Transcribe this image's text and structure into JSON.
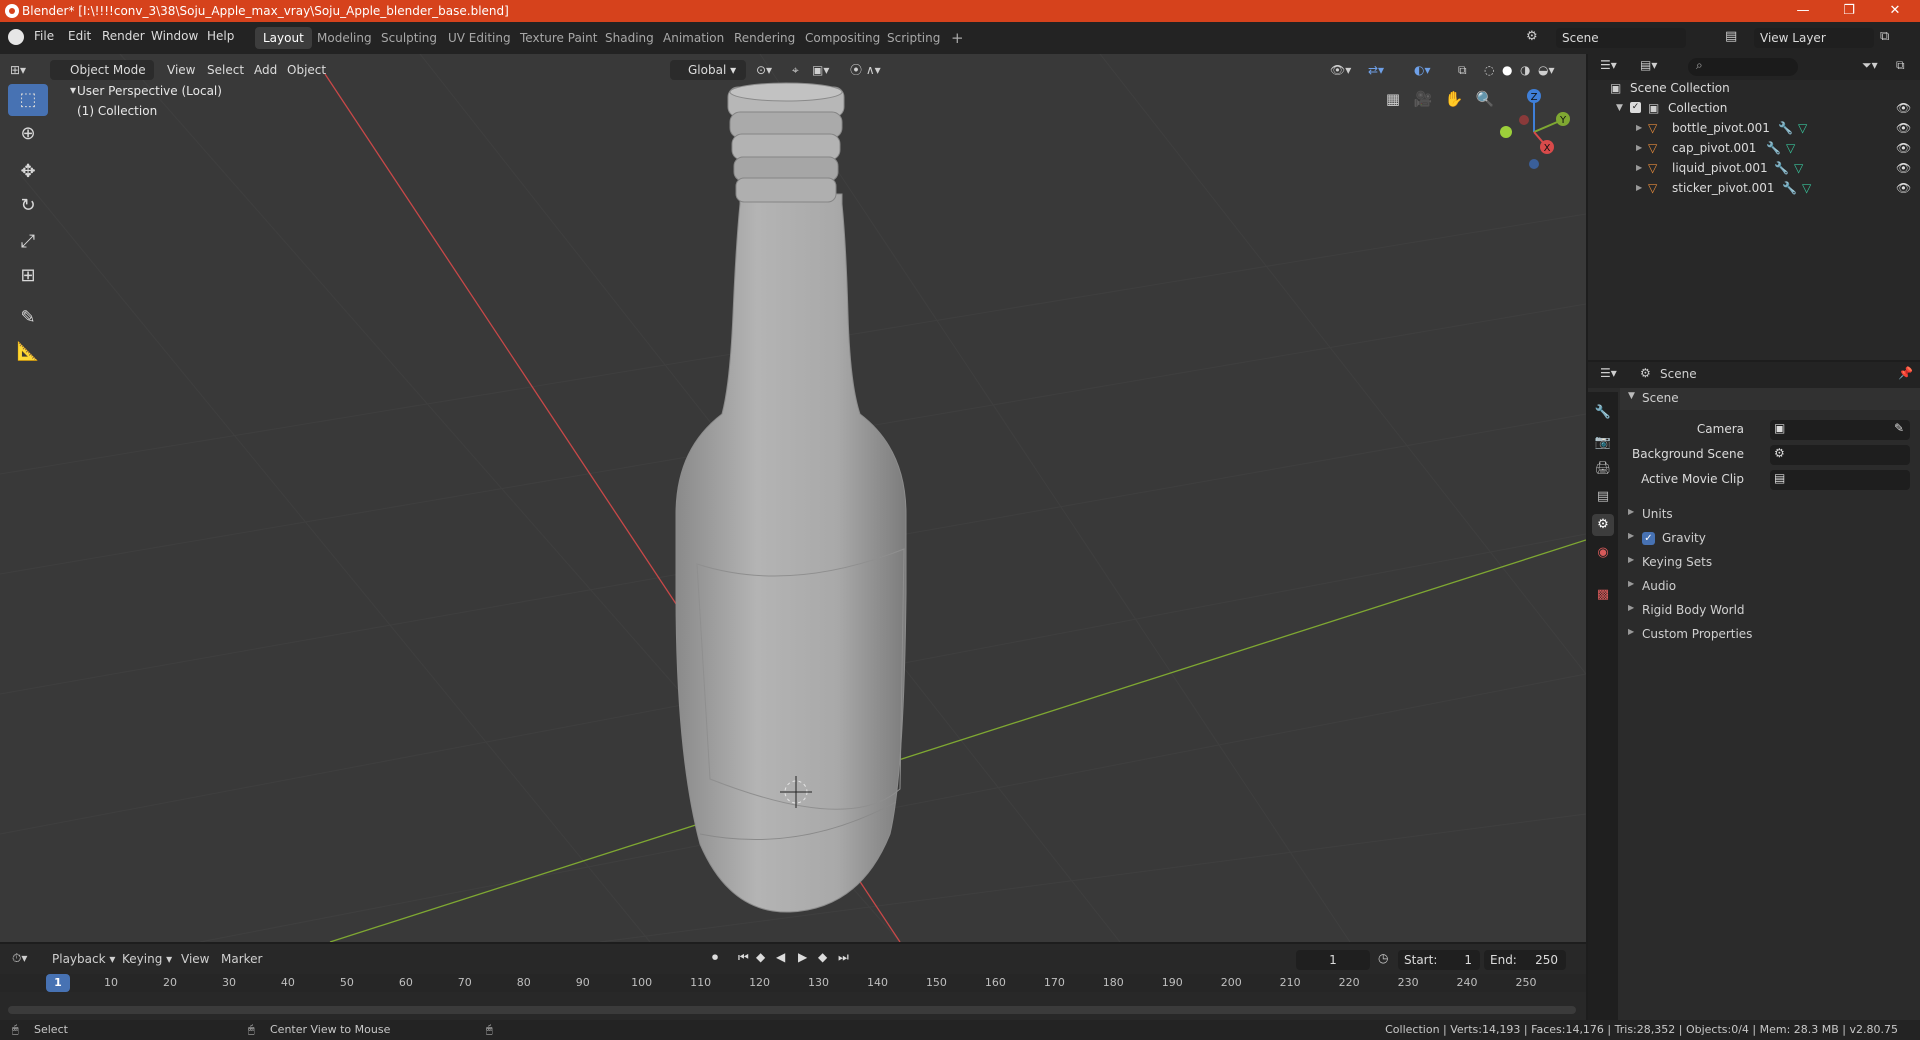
{
  "window": {
    "title": "Blender* [I:\\!!!!conv_3\\38\\Soju_Apple_max_vray\\Soju_Apple_blender_base.blend]",
    "minimize": "—",
    "maximize": "❐",
    "close": "✕"
  },
  "menu": [
    "File",
    "Edit",
    "Render",
    "Window",
    "Help"
  ],
  "workspaces": [
    "Layout",
    "Modeling",
    "Sculpting",
    "UV Editing",
    "Texture Paint",
    "Shading",
    "Animation",
    "Rendering",
    "Compositing",
    "Scripting"
  ],
  "active_workspace": "Layout",
  "add_workspace": "+",
  "scene_field": "Scene",
  "view_layer_field": "View Layer",
  "viewport": {
    "mode": "Object Mode",
    "menus": [
      "View",
      "Select",
      "Add",
      "Object"
    ],
    "orientation": "Global",
    "info_line1": "User Perspective (Local)",
    "info_line2": "(1) Collection",
    "gizmo": {
      "z": "Z",
      "y": "Y",
      "x": "X"
    }
  },
  "outliner": {
    "root": "Scene Collection",
    "collection": "Collection",
    "objects": [
      "bottle_pivot.001",
      "cap_pivot.001",
      "liquid_pivot.001",
      "sticker_pivot.001"
    ]
  },
  "properties": {
    "header": "Scene",
    "panel_title": "Scene",
    "fields": [
      {
        "label": "Camera"
      },
      {
        "label": "Background Scene"
      },
      {
        "label": "Active Movie Clip"
      }
    ],
    "sections": [
      "Units",
      "Gravity",
      "Keying Sets",
      "Audio",
      "Rigid Body World",
      "Custom Properties"
    ],
    "gravity_checked": true
  },
  "timeline": {
    "menus": [
      "Playback",
      "Keying",
      "View",
      "Marker"
    ],
    "current_frame": "1",
    "start_label": "Start:",
    "start_value": "1",
    "end_label": "End:",
    "end_value": "250",
    "ticks": [
      "1",
      "10",
      "20",
      "30",
      "40",
      "50",
      "60",
      "70",
      "80",
      "90",
      "100",
      "110",
      "120",
      "130",
      "140",
      "150",
      "160",
      "170",
      "180",
      "190",
      "200",
      "210",
      "220",
      "230",
      "240",
      "250"
    ]
  },
  "statusbar": {
    "left": "Select",
    "middle": "Center View to Mouse",
    "right": "Collection | Verts:14,193 | Faces:14,176 | Tris:28,352 | Objects:0/4 | Mem: 28.3 MB | v2.80.75"
  },
  "colors": {
    "title_bar": "#d6421c",
    "accent": "#4772b3",
    "axis_x": "#d84a4a",
    "axis_y": "#7fa832",
    "axis_z": "#3f7fd8"
  }
}
